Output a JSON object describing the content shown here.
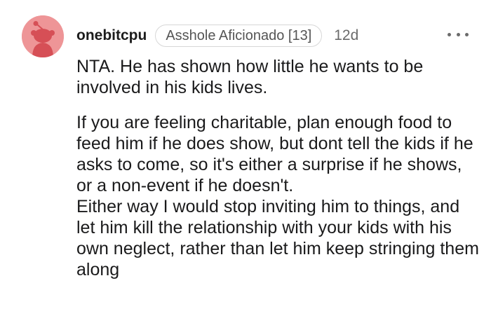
{
  "comment": {
    "username": "onebitcpu",
    "flair": "Asshole Aficionado [13]",
    "timestamp": "12d",
    "more_icon": "more-horizontal-icon",
    "avatar_icon": "reddit-snoo-avatar",
    "avatar_color": "#ee9597",
    "paragraphs": [
      "NTA. He has shown how little he wants to be involved in his kids lives.",
      "If you are feeling charitable, plan enough food to feed him if he does show, but dont tell the kids if he asks to come, so it's either a surprise if he shows, or a non-event if he doesn't.",
      "Either way I would stop inviting him to things, and let him kill the relationship with your kids with his own neglect, rather than let him keep stringing them along"
    ]
  }
}
